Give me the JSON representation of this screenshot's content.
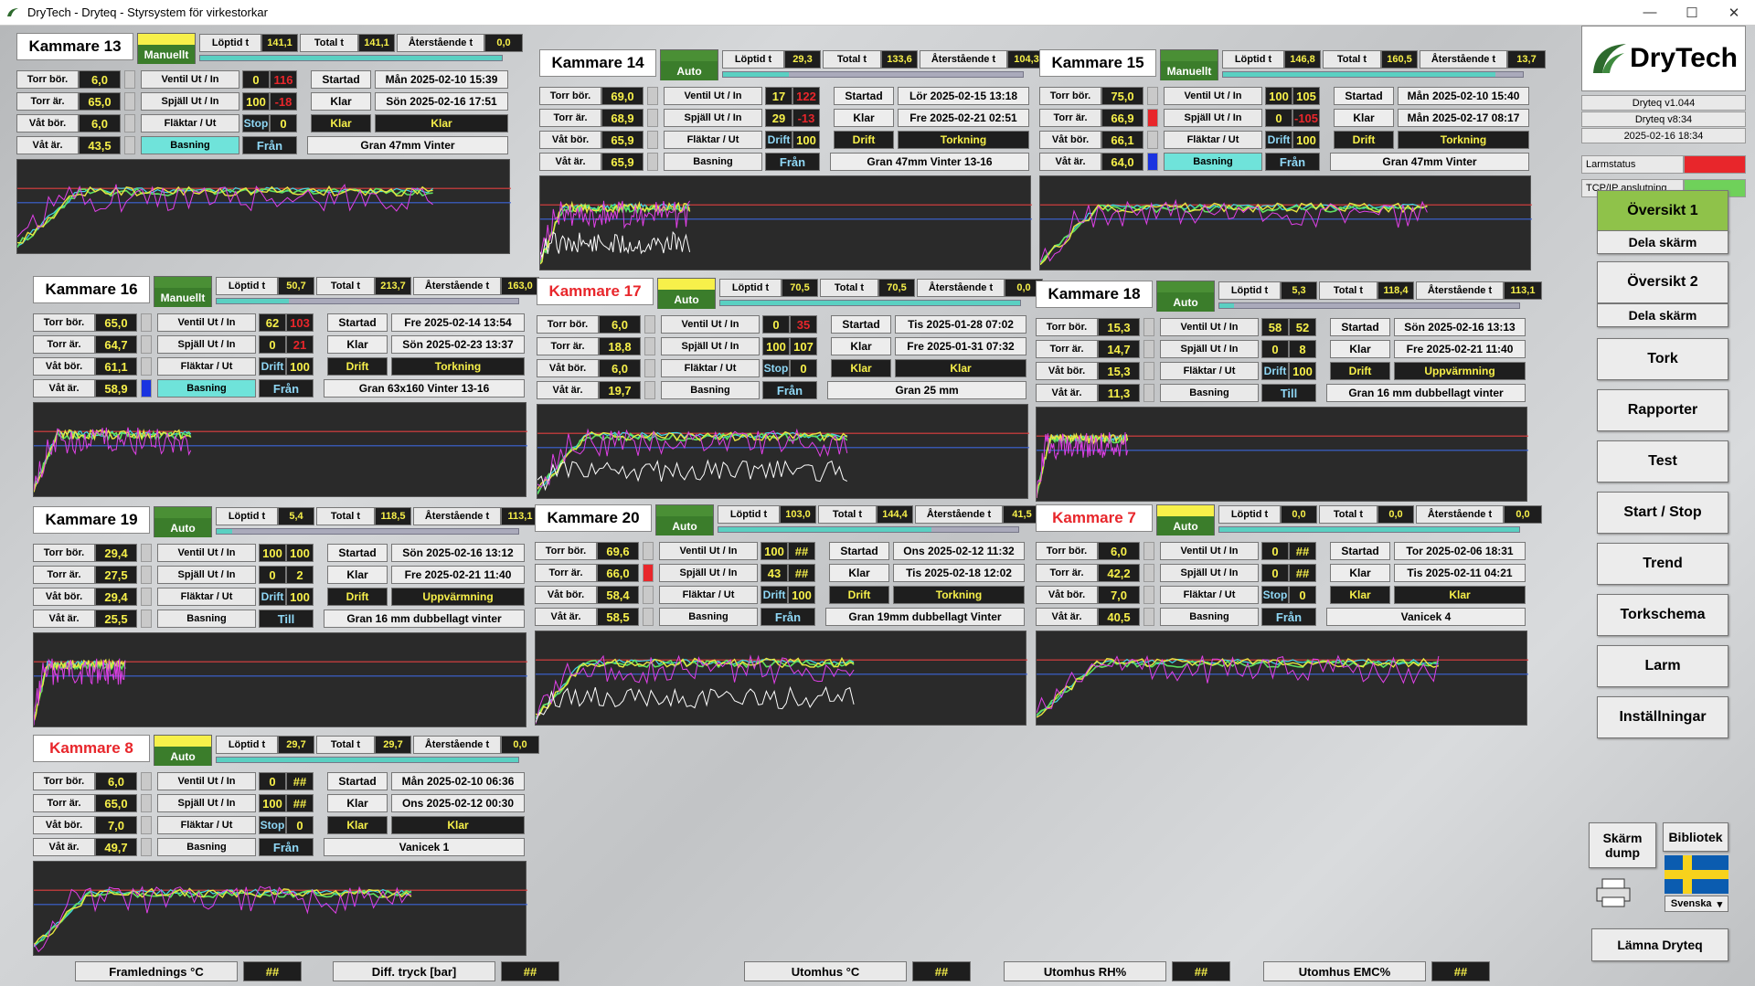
{
  "window": {
    "title": "DryTech - Dryteq - Styrsystem för virkestorkar",
    "minimize": "—",
    "maximize": "☐",
    "close": "✕"
  },
  "labels": {
    "loptid": "Löptid t",
    "total": "Total t",
    "aterstaende": "Återstående t",
    "torr_bor": "Torr bör.",
    "torr_ar": "Torr är.",
    "vat_bor": "Våt bör.",
    "vat_ar": "Våt är.",
    "ventil": "Ventil Ut / In",
    "spjall": "Spjäll Ut / In",
    "faktar": "Fläktar / Ut",
    "basning": "Basning",
    "startad": "Startad",
    "klar": "Klar"
  },
  "chambers": [
    {
      "id": "k13",
      "name": "Kammare 13",
      "alarm": false,
      "mode": "Manuellt",
      "mode_top": "yellow",
      "loptid": "141,1",
      "total": "141,1",
      "aterstaende": "0,0",
      "progress": 1.0,
      "torr_bor": "6,0",
      "torr_ar": "65,0",
      "vat_bor": "6,0",
      "vat_ar": "43,5",
      "ind_torr": "",
      "ind_vat": "",
      "ventil_ut": "0",
      "ventil_in": "116",
      "ventil_in_red": true,
      "spjall_ut": "100",
      "spjall_in": "-18",
      "spjall_in_red": true,
      "fl_state": "Stop",
      "fl_val": "0",
      "fl_drift": "Klar",
      "status": "Klar",
      "bas_cyan": true,
      "bas_state": "Från",
      "startad": "Mån 2025-02-10 15:39",
      "klar": "Sön 2025-02-16 17:51",
      "program": "Gran 47mm Vinter"
    },
    {
      "id": "k14",
      "name": "Kammare 14",
      "alarm": false,
      "mode": "Auto",
      "mode_top": "green",
      "loptid": "29,3",
      "total": "133,6",
      "aterstaende": "104,3",
      "progress": 0.22,
      "torr_bor": "69,0",
      "torr_ar": "68,9",
      "vat_bor": "65,9",
      "vat_ar": "65,9",
      "ind_torr": "",
      "ind_vat": "",
      "ventil_ut": "17",
      "ventil_in": "122",
      "ventil_in_red": true,
      "spjall_ut": "29",
      "spjall_in": "-13",
      "spjall_in_red": true,
      "fl_state": "Drift",
      "fl_val": "100",
      "fl_drift": "Drift",
      "status": "Torkning",
      "bas_cyan": false,
      "bas_state": "Från",
      "startad": "Lör 2025-02-15 13:18",
      "klar": "Fre 2025-02-21 02:51",
      "program": "Gran 47mm Vinter 13-16"
    },
    {
      "id": "k15",
      "name": "Kammare 15",
      "alarm": false,
      "mode": "Manuellt",
      "mode_top": "green",
      "loptid": "146,8",
      "total": "160,5",
      "aterstaende": "13,7",
      "progress": 0.91,
      "torr_bor": "75,0",
      "torr_ar": "66,9",
      "vat_bor": "66,1",
      "vat_ar": "64,0",
      "ind_torr": "red",
      "ind_vat": "blue",
      "ventil_ut": "100",
      "ventil_in": "105",
      "ventil_in_red": false,
      "spjall_ut": "0",
      "spjall_in": "-105",
      "spjall_in_red": true,
      "fl_state": "Drift",
      "fl_val": "100",
      "fl_drift": "Drift",
      "status": "Torkning",
      "bas_cyan": true,
      "bas_state": "Från",
      "startad": "Mån 2025-02-10 15:40",
      "klar": "Mån 2025-02-17 08:17",
      "program": "Gran 47mm Vinter"
    },
    {
      "id": "k16",
      "name": "Kammare 16",
      "alarm": false,
      "mode": "Manuellt",
      "mode_top": "green",
      "loptid": "50,7",
      "total": "213,7",
      "aterstaende": "163,0",
      "progress": 0.24,
      "torr_bor": "65,0",
      "torr_ar": "64,7",
      "vat_bor": "61,1",
      "vat_ar": "58,9",
      "ind_torr": "",
      "ind_vat": "blue",
      "ventil_ut": "62",
      "ventil_in": "103",
      "ventil_in_red": true,
      "spjall_ut": "0",
      "spjall_in": "21",
      "spjall_in_red": true,
      "fl_state": "Drift",
      "fl_val": "100",
      "fl_drift": "Drift",
      "status": "Torkning",
      "bas_cyan": true,
      "bas_state": "Från",
      "startad": "Fre 2025-02-14 13:54",
      "klar": "Sön 2025-02-23 13:37",
      "program": "Gran 63x160 Vinter 13-16"
    },
    {
      "id": "k17",
      "name": "Kammare 17",
      "alarm": true,
      "mode": "Auto",
      "mode_top": "yellow",
      "loptid": "70,5",
      "total": "70,5",
      "aterstaende": "0,0",
      "progress": 1.0,
      "torr_bor": "6,0",
      "torr_ar": "18,8",
      "vat_bor": "6,0",
      "vat_ar": "19,7",
      "ind_torr": "",
      "ind_vat": "",
      "ventil_ut": "0",
      "ventil_in": "35",
      "ventil_in_red": true,
      "spjall_ut": "100",
      "spjall_in": "107",
      "spjall_in_red": false,
      "fl_state": "Stop",
      "fl_val": "0",
      "fl_drift": "Klar",
      "status": "Klar",
      "bas_cyan": false,
      "bas_state": "Från",
      "startad": "Tis 2025-01-28 07:02",
      "klar": "Fre 2025-01-31 07:32",
      "program": "Gran 25 mm"
    },
    {
      "id": "k18",
      "name": "Kammare 18",
      "alarm": false,
      "mode": "Auto",
      "mode_top": "green",
      "loptid": "5,3",
      "total": "118,4",
      "aterstaende": "113,1",
      "progress": 0.05,
      "torr_bor": "15,3",
      "torr_ar": "14,7",
      "vat_bor": "15,3",
      "vat_ar": "11,3",
      "ind_torr": "",
      "ind_vat": "",
      "ventil_ut": "58",
      "ventil_in": "52",
      "ventil_in_red": false,
      "spjall_ut": "0",
      "spjall_in": "8",
      "spjall_in_red": false,
      "fl_state": "Drift",
      "fl_val": "100",
      "fl_drift": "Drift",
      "status": "Uppvärmning",
      "bas_cyan": false,
      "bas_state": "Till",
      "startad": "Sön 2025-02-16 13:13",
      "klar": "Fre 2025-02-21 11:40",
      "program": "Gran 16 mm dubbellagt vinter"
    },
    {
      "id": "k19",
      "name": "Kammare 19",
      "alarm": false,
      "mode": "Auto",
      "mode_top": "green",
      "loptid": "5,4",
      "total": "118,5",
      "aterstaende": "113,1",
      "progress": 0.05,
      "torr_bor": "29,4",
      "torr_ar": "27,5",
      "vat_bor": "29,4",
      "vat_ar": "25,5",
      "ind_torr": "",
      "ind_vat": "",
      "ventil_ut": "100",
      "ventil_in": "100",
      "ventil_in_red": false,
      "spjall_ut": "0",
      "spjall_in": "2",
      "spjall_in_red": false,
      "fl_state": "Drift",
      "fl_val": "100",
      "fl_drift": "Drift",
      "status": "Uppvärmning",
      "bas_cyan": false,
      "bas_state": "Till",
      "startad": "Sön 2025-02-16 13:12",
      "klar": "Fre 2025-02-21 11:40",
      "program": "Gran 16 mm dubbellagt vinter"
    },
    {
      "id": "k20",
      "name": "Kammare 20",
      "alarm": false,
      "mode": "Auto",
      "mode_top": "green",
      "loptid": "103,0",
      "total": "144,4",
      "aterstaende": "41,5",
      "progress": 0.71,
      "torr_bor": "69,6",
      "torr_ar": "66,0",
      "vat_bor": "58,4",
      "vat_ar": "58,5",
      "ind_torr": "red",
      "ind_vat": "",
      "ventil_ut": "100",
      "ventil_in": "##",
      "ventil_in_red": false,
      "spjall_ut": "43",
      "spjall_in": "##",
      "spjall_in_red": false,
      "fl_state": "Drift",
      "fl_val": "100",
      "fl_drift": "Drift",
      "status": "Torkning",
      "bas_cyan": false,
      "bas_state": "Från",
      "startad": "Ons 2025-02-12 11:32",
      "klar": "Tis 2025-02-18 12:02",
      "program": "Gran 19mm dubbellagt Vinter"
    },
    {
      "id": "k7",
      "name": "Kammare 7",
      "alarm": true,
      "mode": "Auto",
      "mode_top": "yellow",
      "loptid": "0,0",
      "total": "0,0",
      "aterstaende": "0,0",
      "progress": 1.0,
      "torr_bor": "6,0",
      "torr_ar": "42,2",
      "vat_bor": "7,0",
      "vat_ar": "40,5",
      "ind_torr": "",
      "ind_vat": "",
      "ventil_ut": "0",
      "ventil_in": "##",
      "ventil_in_red": false,
      "spjall_ut": "0",
      "spjall_in": "##",
      "spjall_in_red": false,
      "fl_state": "Stop",
      "fl_val": "0",
      "fl_drift": "Klar",
      "status": "Klar",
      "bas_cyan": false,
      "bas_state": "Från",
      "startad": "Tor 2025-02-06 18:31",
      "klar": "Tis 2025-02-11 04:21",
      "program": "Vanicek 4"
    },
    {
      "id": "k8",
      "name": "Kammare 8",
      "alarm": true,
      "mode": "Auto",
      "mode_top": "yellow",
      "loptid": "29,7",
      "total": "29,7",
      "aterstaende": "0,0",
      "progress": 1.0,
      "torr_bor": "6,0",
      "torr_ar": "65,0",
      "vat_bor": "7,0",
      "vat_ar": "49,7",
      "ind_torr": "",
      "ind_vat": "",
      "ventil_ut": "0",
      "ventil_in": "##",
      "ventil_in_red": false,
      "spjall_ut": "100",
      "spjall_in": "##",
      "spjall_in_red": false,
      "fl_state": "Stop",
      "fl_val": "0",
      "fl_drift": "Klar",
      "status": "Klar",
      "bas_cyan": false,
      "bas_state": "Från",
      "startad": "Mån 2025-02-10 06:36",
      "klar": "Ons 2025-02-12 00:30",
      "program": "Vanicek 1"
    }
  ],
  "sidebar": {
    "logo": "DryTech",
    "version": "Dryteq v1.044",
    "user": "Dryteq v8:34",
    "datetime": "2025-02-16 18:34",
    "larmstatus": "Larmstatus",
    "tcpip": "TCP/IP anslutning",
    "larm_color": "#e8262b",
    "tcp_color": "#6fd15a",
    "nav": [
      "Översikt 1",
      "Dela skärm",
      "Översikt 2",
      "Dela skärm",
      "Tork",
      "Rapporter",
      "Test",
      "Start / Stop",
      "Trend",
      "Torkschema",
      "Larm",
      "Inställningar"
    ],
    "skarmdump": "Skärm dump",
    "bibliotek": "Bibliotek",
    "language": "Svenska",
    "lamna": "Lämna Dryteq"
  },
  "bottom": [
    {
      "label": "Framlednings °C",
      "value": "##"
    },
    {
      "label": "Diff. tryck [bar]",
      "value": "##"
    },
    {
      "label": "Utomhus °C",
      "value": "##"
    },
    {
      "label": "Utomhus RH%",
      "value": "##"
    },
    {
      "label": "Utomhus EMC%",
      "value": "##"
    }
  ],
  "colors": {
    "red_line": "#e04040",
    "blue_line": "#3c64d8",
    "yellow_line": "#e8e640",
    "green_line": "#5fe05f",
    "magenta_line": "#e040e8",
    "white_line": "#ffffff",
    "cyan_line": "#40d8e8"
  }
}
